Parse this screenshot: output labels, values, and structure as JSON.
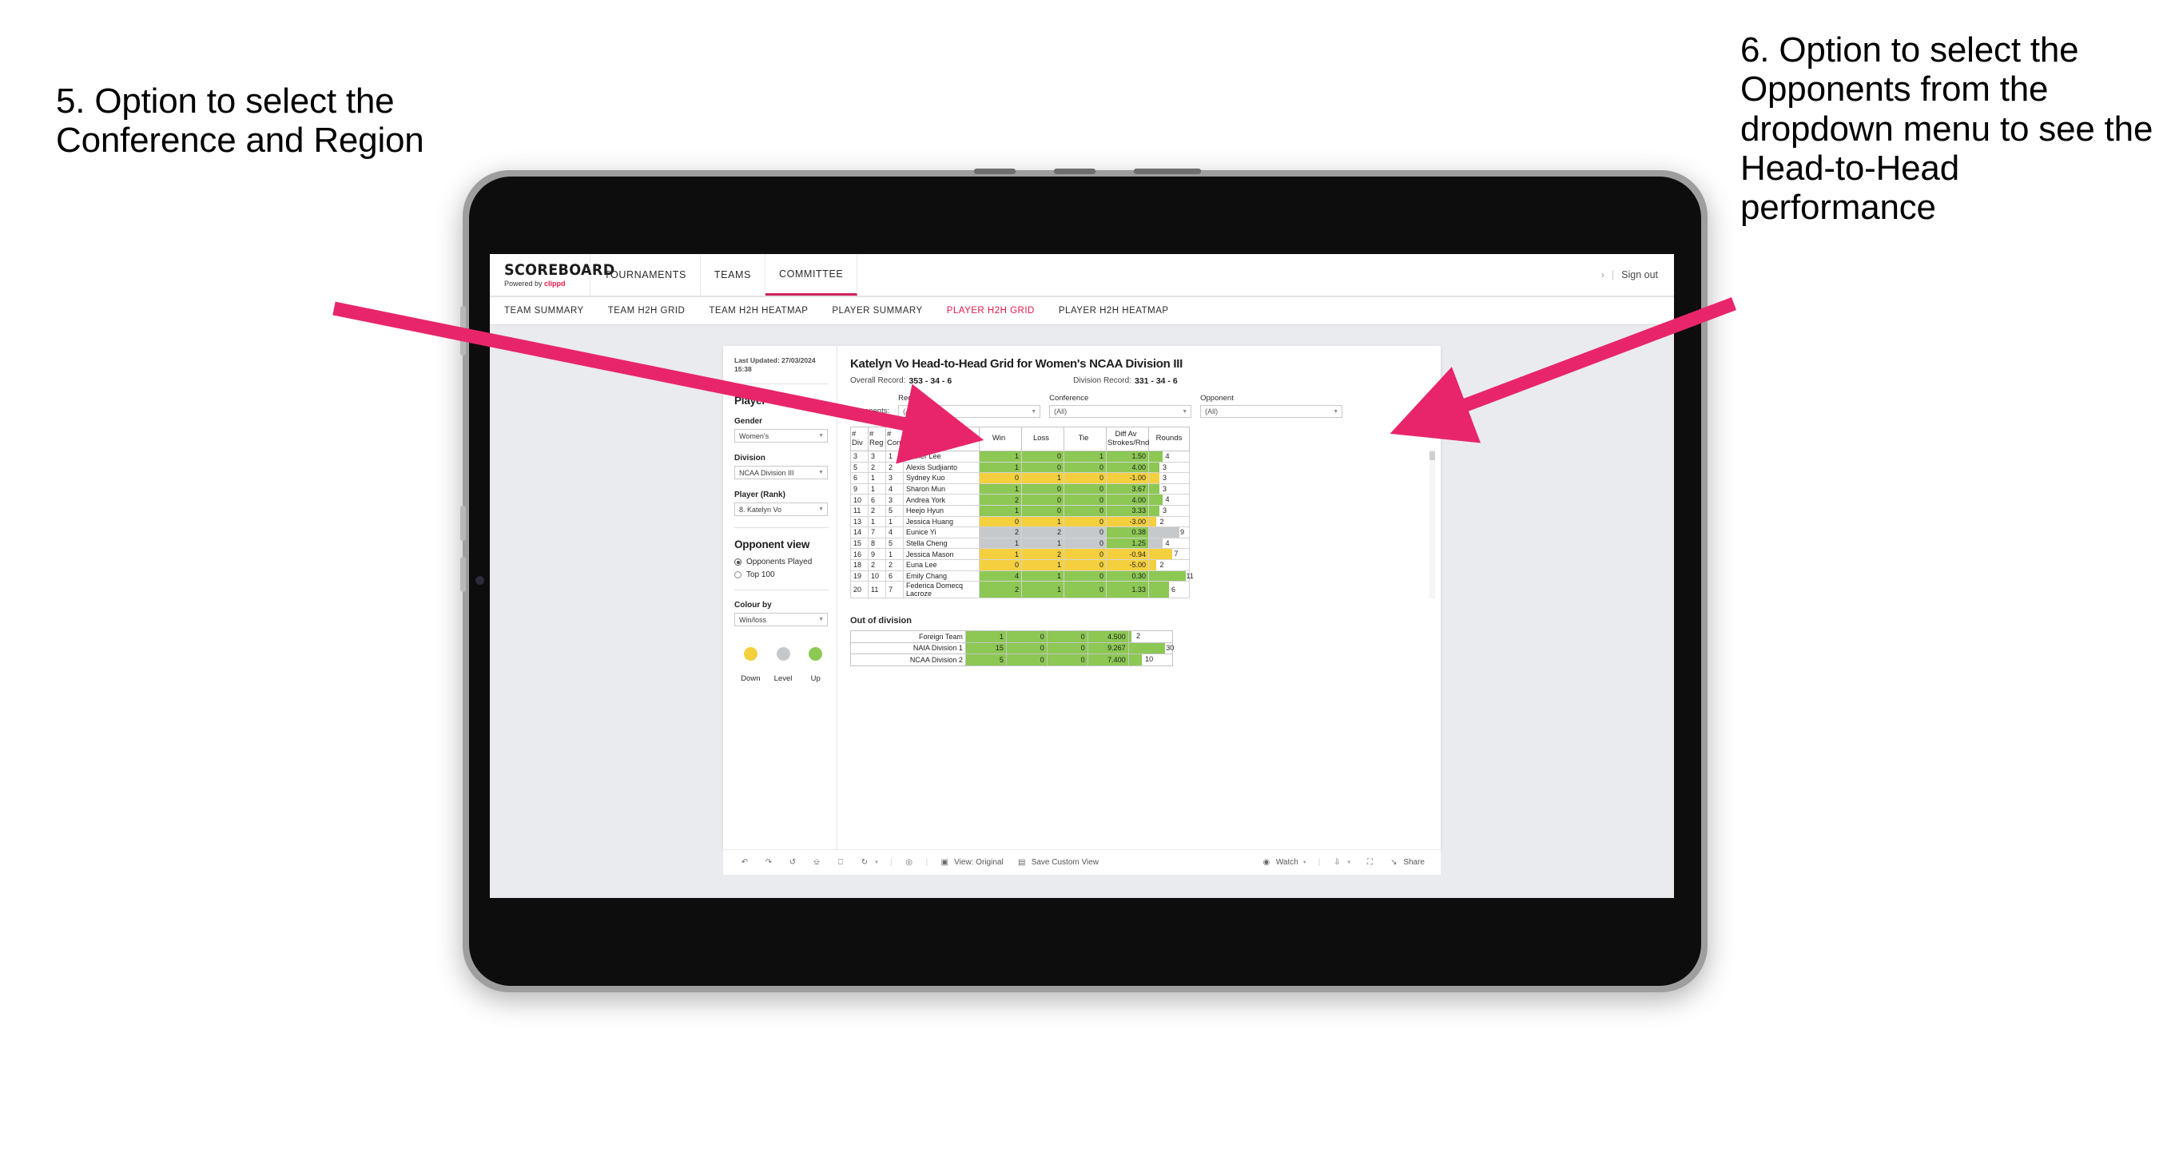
{
  "annotations": {
    "left": "5. Option to select the Conference and Region",
    "right": "6. Option to select the Opponents from the dropdown menu to see the Head-to-Head performance"
  },
  "app": {
    "logo": {
      "main": "SCOREBOARD",
      "powered": "Powered by",
      "brand": "clippd"
    },
    "top_nav": [
      {
        "label": "TOURNAMENTS",
        "active": false
      },
      {
        "label": "TEAMS",
        "active": false
      },
      {
        "label": "COMMITTEE",
        "active": true
      }
    ],
    "sign_out": "Sign out",
    "sub_nav": [
      {
        "label": "TEAM SUMMARY",
        "active": false
      },
      {
        "label": "TEAM H2H GRID",
        "active": false
      },
      {
        "label": "TEAM H2H HEATMAP",
        "active": false
      },
      {
        "label": "PLAYER SUMMARY",
        "active": false
      },
      {
        "label": "PLAYER H2H GRID",
        "active": true
      },
      {
        "label": "PLAYER H2H HEATMAP",
        "active": false
      }
    ]
  },
  "sidebar": {
    "last_updated": "Last Updated: 27/03/2024 15:38",
    "player_heading": "Player",
    "gender": {
      "label": "Gender",
      "value": "Women's"
    },
    "division": {
      "label": "Division",
      "value": "NCAA Division III"
    },
    "player_rank": {
      "label": "Player (Rank)",
      "value": "8. Katelyn Vo"
    },
    "opponent_view": {
      "heading": "Opponent view",
      "options": [
        {
          "label": "Opponents Played",
          "selected": true
        },
        {
          "label": "Top 100",
          "selected": false
        }
      ]
    },
    "colour_by": {
      "label": "Colour by",
      "value": "Win/loss"
    },
    "legend": [
      {
        "label": "Down",
        "color": "#f4d03f"
      },
      {
        "label": "Level",
        "color": "#c6c9cc"
      },
      {
        "label": "Up",
        "color": "#8cc853"
      }
    ]
  },
  "main": {
    "title": "Katelyn Vo Head-to-Head Grid for Women's NCAA Division III",
    "overall_record_label": "Overall Record:",
    "overall_record_value": "353 - 34 - 6",
    "division_record_label": "Division Record:",
    "division_record_value": "331 - 34 - 6",
    "opponents_label": "Opponents:",
    "filters": [
      {
        "label": "Region",
        "value": "(All)"
      },
      {
        "label": "Conference",
        "value": "(All)"
      },
      {
        "label": "Opponent",
        "value": "(All)"
      }
    ],
    "table": {
      "headers": [
        "#\nDiv",
        "#\nReg",
        "#\nConf",
        "Opponent",
        "Win",
        "Loss",
        "Tie",
        "Diff Av\nStrokes/Rnd",
        "Rounds"
      ],
      "header_div": "# Div",
      "header_reg": "# Reg",
      "header_conf": "# Conf",
      "header_opponent": "Opponent",
      "header_win": "Win",
      "header_loss": "Loss",
      "header_tie": "Tie",
      "header_diff": "Diff Av Strokes/Rnd",
      "header_rounds": "Rounds",
      "rows": [
        {
          "div": "3",
          "reg": "3",
          "conf": "1",
          "opponent": "Esther Lee",
          "win": "1",
          "loss": "0",
          "tie": "1",
          "diff": "1.50",
          "rounds": "4",
          "color": "green",
          "bar_pct": 33
        },
        {
          "div": "5",
          "reg": "2",
          "conf": "2",
          "opponent": "Alexis Sudjianto",
          "win": "1",
          "loss": "0",
          "tie": "0",
          "diff": "4.00",
          "rounds": "3",
          "color": "green",
          "bar_pct": 25
        },
        {
          "div": "6",
          "reg": "1",
          "conf": "3",
          "opponent": "Sydney Kuo",
          "win": "0",
          "loss": "1",
          "tie": "0",
          "diff": "-1.00",
          "rounds": "3",
          "color": "yellow",
          "bar_pct": 25
        },
        {
          "div": "9",
          "reg": "1",
          "conf": "4",
          "opponent": "Sharon Mun",
          "win": "1",
          "loss": "0",
          "tie": "0",
          "diff": "3.67",
          "rounds": "3",
          "color": "green",
          "bar_pct": 25
        },
        {
          "div": "10",
          "reg": "6",
          "conf": "3",
          "opponent": "Andrea York",
          "win": "2",
          "loss": "0",
          "tie": "0",
          "diff": "4.00",
          "rounds": "4",
          "color": "green",
          "bar_pct": 33
        },
        {
          "div": "11",
          "reg": "2",
          "conf": "5",
          "opponent": "Heejo Hyun",
          "win": "1",
          "loss": "0",
          "tie": "0",
          "diff": "3.33",
          "rounds": "3",
          "color": "green",
          "bar_pct": 25
        },
        {
          "div": "13",
          "reg": "1",
          "conf": "1",
          "opponent": "Jessica Huang",
          "win": "0",
          "loss": "1",
          "tie": "0",
          "diff": "-3.00",
          "rounds": "2",
          "color": "yellow",
          "bar_pct": 17
        },
        {
          "div": "14",
          "reg": "7",
          "conf": "4",
          "opponent": "Eunice Yi",
          "win": "2",
          "loss": "2",
          "tie": "0",
          "diff": "0.38",
          "rounds": "9",
          "color": "grey",
          "bar_pct": 75
        },
        {
          "div": "15",
          "reg": "8",
          "conf": "5",
          "opponent": "Stella Cheng",
          "win": "1",
          "loss": "1",
          "tie": "0",
          "diff": "1.25",
          "rounds": "4",
          "color": "grey",
          "bar_pct": 33
        },
        {
          "div": "16",
          "reg": "9",
          "conf": "1",
          "opponent": "Jessica Mason",
          "win": "1",
          "loss": "2",
          "tie": "0",
          "diff": "-0.94",
          "rounds": "7",
          "color": "yellow",
          "bar_pct": 58
        },
        {
          "div": "18",
          "reg": "2",
          "conf": "2",
          "opponent": "Euna Lee",
          "win": "0",
          "loss": "1",
          "tie": "0",
          "diff": "-5.00",
          "rounds": "2",
          "color": "yellow",
          "bar_pct": 17
        },
        {
          "div": "19",
          "reg": "10",
          "conf": "6",
          "opponent": "Emily Chang",
          "win": "4",
          "loss": "1",
          "tie": "0",
          "diff": "0.30",
          "rounds": "11",
          "color": "green",
          "bar_pct": 92
        },
        {
          "div": "20",
          "reg": "11",
          "conf": "7",
          "opponent": "Federica Domecq Lacroze",
          "win": "2",
          "loss": "1",
          "tie": "0",
          "diff": "1.33",
          "rounds": "6",
          "color": "green",
          "bar_pct": 50
        }
      ]
    },
    "out_of_division": {
      "title": "Out of division",
      "rows": [
        {
          "name": "Foreign Team",
          "win": "1",
          "loss": "0",
          "tie": "0",
          "diff": "4.500",
          "rounds": "2",
          "color": "green",
          "bar_pct": 7
        },
        {
          "name": "NAIA Division 1",
          "win": "15",
          "loss": "0",
          "tie": "0",
          "diff": "9.267",
          "rounds": "30",
          "color": "green",
          "bar_pct": 84
        },
        {
          "name": "NCAA Division 2",
          "win": "5",
          "loss": "0",
          "tie": "0",
          "diff": "7.400",
          "rounds": "10",
          "color": "green",
          "bar_pct": 30
        }
      ]
    }
  },
  "toolbar": {
    "view_label": "View: Original",
    "save_label": "Save Custom View",
    "watch_label": "Watch",
    "share_label": "Share"
  },
  "colors": {
    "brand_pink": "#e8174c",
    "accent_active": "#d1215b",
    "arrow": "#e8256b",
    "green": "#8cc853",
    "yellow": "#f4d03f",
    "grey": "#c6c9cc"
  },
  "chart_data": {
    "type": "table",
    "title": "Katelyn Vo Head-to-Head Grid for Women's NCAA Division III",
    "columns": [
      "# Div",
      "# Reg",
      "# Conf",
      "Opponent",
      "Win",
      "Loss",
      "Tie",
      "Diff Av Strokes/Rnd",
      "Rounds"
    ],
    "rows": [
      [
        "3",
        "3",
        "1",
        "Esther Lee",
        "1",
        "0",
        "1",
        "1.50",
        "4"
      ],
      [
        "5",
        "2",
        "2",
        "Alexis Sudjianto",
        "1",
        "0",
        "0",
        "4.00",
        "3"
      ],
      [
        "6",
        "1",
        "3",
        "Sydney Kuo",
        "0",
        "1",
        "0",
        "-1.00",
        "3"
      ],
      [
        "9",
        "1",
        "4",
        "Sharon Mun",
        "1",
        "0",
        "0",
        "3.67",
        "3"
      ],
      [
        "10",
        "6",
        "3",
        "Andrea York",
        "2",
        "0",
        "0",
        "4.00",
        "4"
      ],
      [
        "11",
        "2",
        "5",
        "Heejo Hyun",
        "1",
        "0",
        "0",
        "3.33",
        "3"
      ],
      [
        "13",
        "1",
        "1",
        "Jessica Huang",
        "0",
        "1",
        "0",
        "-3.00",
        "2"
      ],
      [
        "14",
        "7",
        "4",
        "Eunice Yi",
        "2",
        "2",
        "0",
        "0.38",
        "9"
      ],
      [
        "15",
        "8",
        "5",
        "Stella Cheng",
        "1",
        "1",
        "0",
        "1.25",
        "4"
      ],
      [
        "16",
        "9",
        "1",
        "Jessica Mason",
        "1",
        "2",
        "0",
        "-0.94",
        "7"
      ],
      [
        "18",
        "2",
        "2",
        "Euna Lee",
        "0",
        "1",
        "0",
        "-5.00",
        "2"
      ],
      [
        "19",
        "10",
        "6",
        "Emily Chang",
        "4",
        "1",
        "0",
        "0.30",
        "11"
      ],
      [
        "20",
        "11",
        "7",
        "Federica Domecq Lacroze",
        "2",
        "1",
        "0",
        "1.33",
        "6"
      ]
    ],
    "out_of_division_rows": [
      [
        "Foreign Team",
        "1",
        "0",
        "0",
        "4.500",
        "2"
      ],
      [
        "NAIA Division 1",
        "15",
        "0",
        "0",
        "9.267",
        "30"
      ],
      [
        "NCAA Division 2",
        "5",
        "0",
        "0",
        "7.400",
        "10"
      ]
    ],
    "legend": [
      {
        "label": "Down",
        "color": "#f4d03f"
      },
      {
        "label": "Level",
        "color": "#c6c9cc"
      },
      {
        "label": "Up",
        "color": "#8cc853"
      }
    ]
  }
}
